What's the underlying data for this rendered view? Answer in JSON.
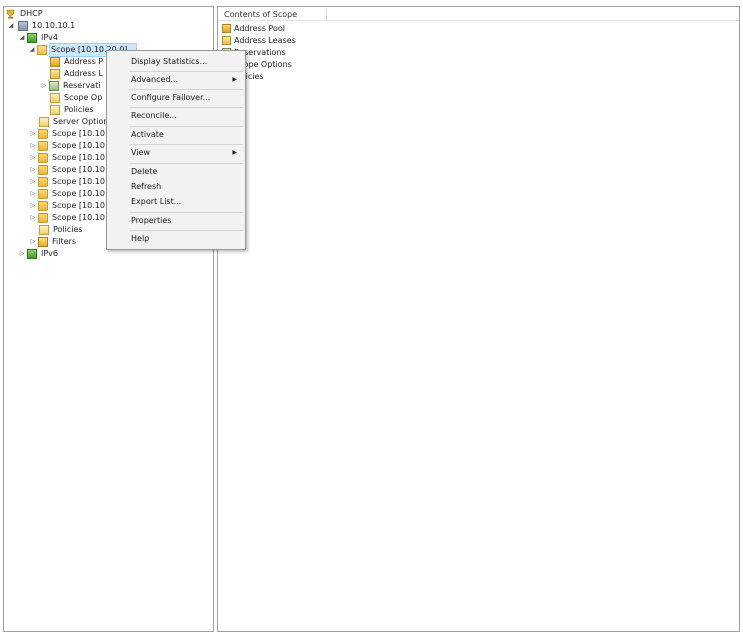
{
  "tree": {
    "root": "DHCP",
    "server": "10.10.10.1",
    "ipv4": "IPv4",
    "selected_scope": "Scope [10.10.20.0]...",
    "scope_children": [
      "Address P",
      "Address L",
      "Reservati",
      "Scope Op",
      "Policies"
    ],
    "server_options": "Server Optior",
    "other_scopes": [
      "Scope [10.10",
      "Scope [10.10",
      "Scope [10.10",
      "Scope [10.10",
      "Scope [10.10",
      "Scope [10.10",
      "Scope [10.10",
      "Scope [10.10"
    ],
    "policies": "Policies",
    "filters": "Filters",
    "ipv6": "IPv6"
  },
  "list": {
    "header": "Contents of Scope",
    "items": [
      "Address Pool",
      "Address Leases",
      "Reservations",
      "Scope Options",
      "Policies"
    ]
  },
  "context_menu": {
    "items": [
      "Display Statistics...",
      "Advanced...",
      "Configure Failover...",
      "Reconcile...",
      "Activate",
      "View",
      "Delete",
      "Refresh",
      "Export List...",
      "Properties",
      "Help"
    ]
  },
  "icons": {
    "root": "dhcp-trophy-icon",
    "server": "server-icon",
    "ipv": "network-protocol-icon",
    "scope": "folder-icon",
    "submenu": "submenu-arrow-icon"
  }
}
